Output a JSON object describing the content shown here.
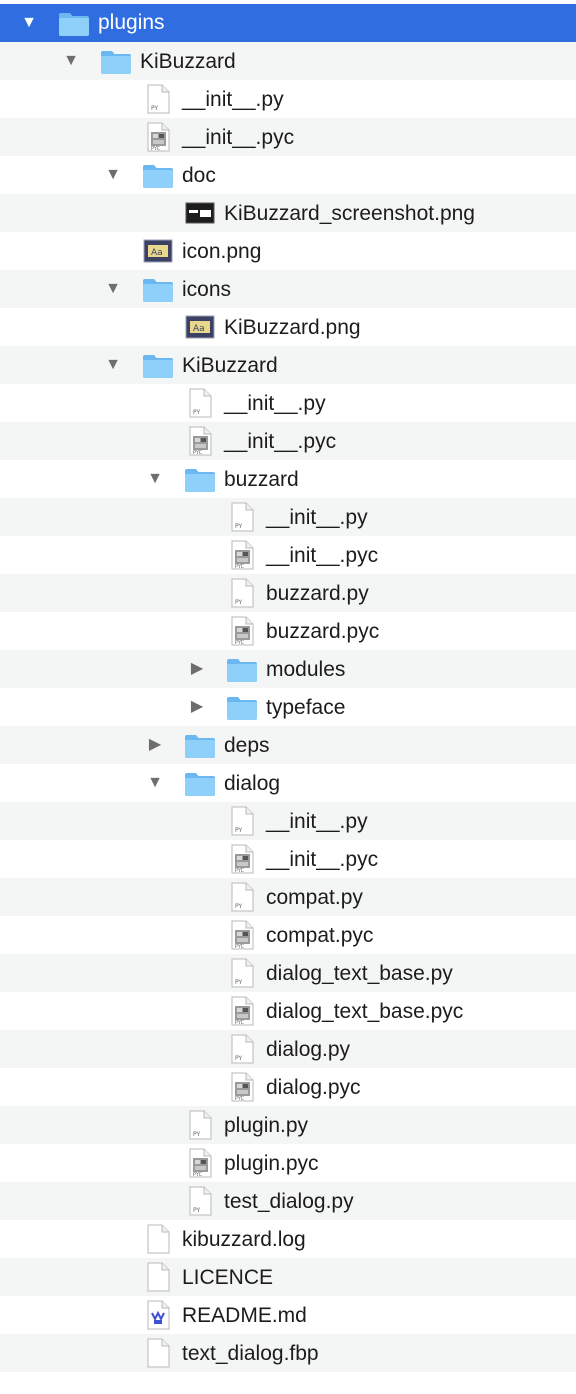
{
  "colors": {
    "selection": "#2f6de0",
    "folder": "#7cc6f6",
    "stripe": "#f4f5f5"
  },
  "tree": [
    {
      "label": "plugins",
      "icon": "folder-icon",
      "depth": 0,
      "disclosure": "expanded",
      "selected": true
    },
    {
      "label": "KiBuzzard",
      "icon": "folder-icon",
      "depth": 1,
      "disclosure": "expanded"
    },
    {
      "label": "__init__.py",
      "icon": "python-file-icon",
      "depth": 2
    },
    {
      "label": "__init__.pyc",
      "icon": "compiled-python-file-icon",
      "depth": 2
    },
    {
      "label": "doc",
      "icon": "folder-icon",
      "depth": 2,
      "disclosure": "expanded"
    },
    {
      "label": "KiBuzzard_screenshot.png",
      "icon": "screenshot-image-icon",
      "depth": 3
    },
    {
      "label": "icon.png",
      "icon": "image-icon",
      "depth": 2
    },
    {
      "label": "icons",
      "icon": "folder-icon",
      "depth": 2,
      "disclosure": "expanded"
    },
    {
      "label": "KiBuzzard.png",
      "icon": "image-icon",
      "depth": 3
    },
    {
      "label": "KiBuzzard",
      "icon": "folder-icon",
      "depth": 2,
      "disclosure": "expanded"
    },
    {
      "label": "__init__.py",
      "icon": "python-file-icon",
      "depth": 3
    },
    {
      "label": "__init__.pyc",
      "icon": "compiled-python-file-icon",
      "depth": 3
    },
    {
      "label": "buzzard",
      "icon": "folder-icon",
      "depth": 3,
      "disclosure": "expanded"
    },
    {
      "label": "__init__.py",
      "icon": "python-file-icon",
      "depth": 4
    },
    {
      "label": "__init__.pyc",
      "icon": "compiled-python-file-icon",
      "depth": 4
    },
    {
      "label": "buzzard.py",
      "icon": "python-file-icon",
      "depth": 4
    },
    {
      "label": "buzzard.pyc",
      "icon": "compiled-python-file-icon",
      "depth": 4
    },
    {
      "label": "modules",
      "icon": "folder-icon",
      "depth": 4,
      "disclosure": "collapsed"
    },
    {
      "label": "typeface",
      "icon": "folder-icon",
      "depth": 4,
      "disclosure": "collapsed"
    },
    {
      "label": "deps",
      "icon": "folder-icon",
      "depth": 3,
      "disclosure": "collapsed"
    },
    {
      "label": "dialog",
      "icon": "folder-icon",
      "depth": 3,
      "disclosure": "expanded"
    },
    {
      "label": "__init__.py",
      "icon": "python-file-icon",
      "depth": 4
    },
    {
      "label": "__init__.pyc",
      "icon": "compiled-python-file-icon",
      "depth": 4
    },
    {
      "label": "compat.py",
      "icon": "python-file-icon",
      "depth": 4
    },
    {
      "label": "compat.pyc",
      "icon": "compiled-python-file-icon",
      "depth": 4
    },
    {
      "label": "dialog_text_base.py",
      "icon": "python-file-icon",
      "depth": 4
    },
    {
      "label": "dialog_text_base.pyc",
      "icon": "compiled-python-file-icon",
      "depth": 4
    },
    {
      "label": "dialog.py",
      "icon": "python-file-icon",
      "depth": 4
    },
    {
      "label": "dialog.pyc",
      "icon": "compiled-python-file-icon",
      "depth": 4
    },
    {
      "label": "plugin.py",
      "icon": "python-file-icon",
      "depth": 3
    },
    {
      "label": "plugin.pyc",
      "icon": "compiled-python-file-icon",
      "depth": 3
    },
    {
      "label": "test_dialog.py",
      "icon": "python-file-icon",
      "depth": 3
    },
    {
      "label": "kibuzzard.log",
      "icon": "document-icon",
      "depth": 2
    },
    {
      "label": "LICENCE",
      "icon": "document-icon",
      "depth": 2
    },
    {
      "label": "README.md",
      "icon": "markdown-file-icon",
      "depth": 2
    },
    {
      "label": "text_dialog.fbp",
      "icon": "document-icon",
      "depth": 2
    }
  ]
}
